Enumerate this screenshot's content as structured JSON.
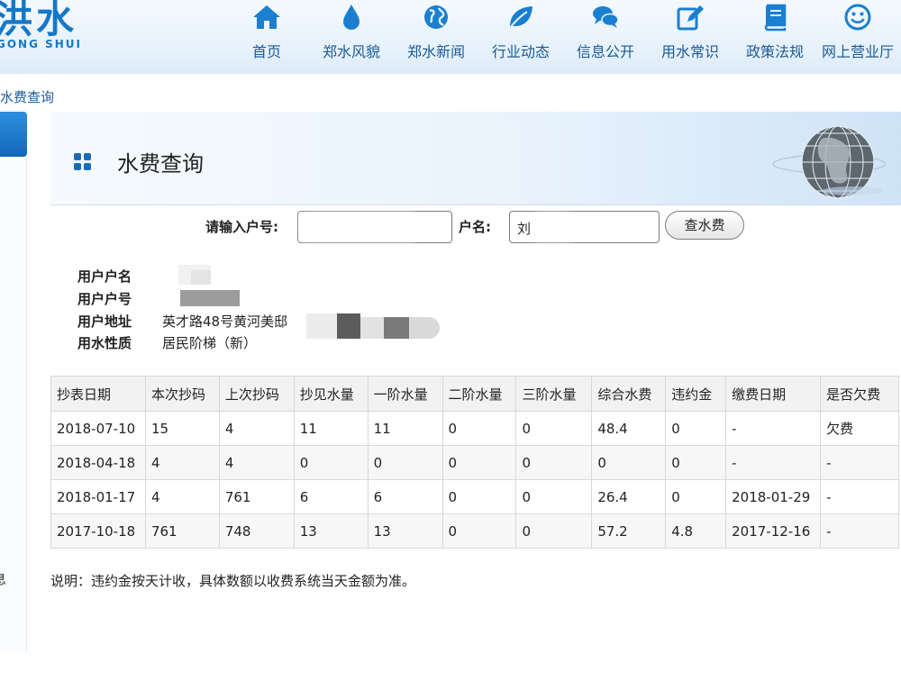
{
  "header": {
    "logo_text": "洪水",
    "logo_subtext": "GONG SHUI",
    "nav": [
      {
        "label": "首页",
        "icon": "home-icon"
      },
      {
        "label": "郑水风貌",
        "icon": "water-drop-icon"
      },
      {
        "label": "郑水新闻",
        "icon": "globe-icon"
      },
      {
        "label": "行业动态",
        "icon": "leaf-icon"
      },
      {
        "label": "信息公开",
        "icon": "chat-bubbles-icon"
      },
      {
        "label": "用水常识",
        "icon": "edit-icon"
      },
      {
        "label": "政策法规",
        "icon": "book-icon"
      },
      {
        "label": "网上营业厅",
        "icon": "smiley-icon"
      }
    ],
    "accent": "#1577c8"
  },
  "breadcrumb": "水费查询",
  "side": {
    "partial_text": "息"
  },
  "banner": {
    "title": "水费查询"
  },
  "search": {
    "account_label": "请输入户号:",
    "account_value": "",
    "name_label": "户名:",
    "name_value": "刘",
    "submit_label": "查水费"
  },
  "info": {
    "name_label": "用户户名",
    "name_value": "",
    "account_label": "用户户号",
    "account_value": "",
    "address_label": "用户地址",
    "address_value": "英才路48号黄河美邸",
    "type_label": "用水性质",
    "type_value": "居民阶梯（新）"
  },
  "table": {
    "headers": [
      "抄表日期",
      "本次抄码",
      "上次抄码",
      "抄见水量",
      "一阶水量",
      "二阶水量",
      "三阶水量",
      "综合水费",
      "违约金",
      "缴费日期",
      "是否欠费"
    ],
    "rows": [
      [
        "2018-07-10",
        "15",
        "4",
        "11",
        "11",
        "0",
        "0",
        "48.4",
        "0",
        "-",
        "欠费"
      ],
      [
        "2018-04-18",
        "4",
        "4",
        "0",
        "0",
        "0",
        "0",
        "0",
        "0",
        "-",
        "-"
      ],
      [
        "2018-01-17",
        "4",
        "761",
        "6",
        "6",
        "0",
        "0",
        "26.4",
        "0",
        "2018-01-29",
        "-"
      ],
      [
        "2017-10-18",
        "761",
        "748",
        "13",
        "13",
        "0",
        "0",
        "57.2",
        "4.8",
        "2017-12-16",
        "-"
      ]
    ]
  },
  "note": "说明：违约金按天计收，具体数额以收费系统当天金额为准。"
}
